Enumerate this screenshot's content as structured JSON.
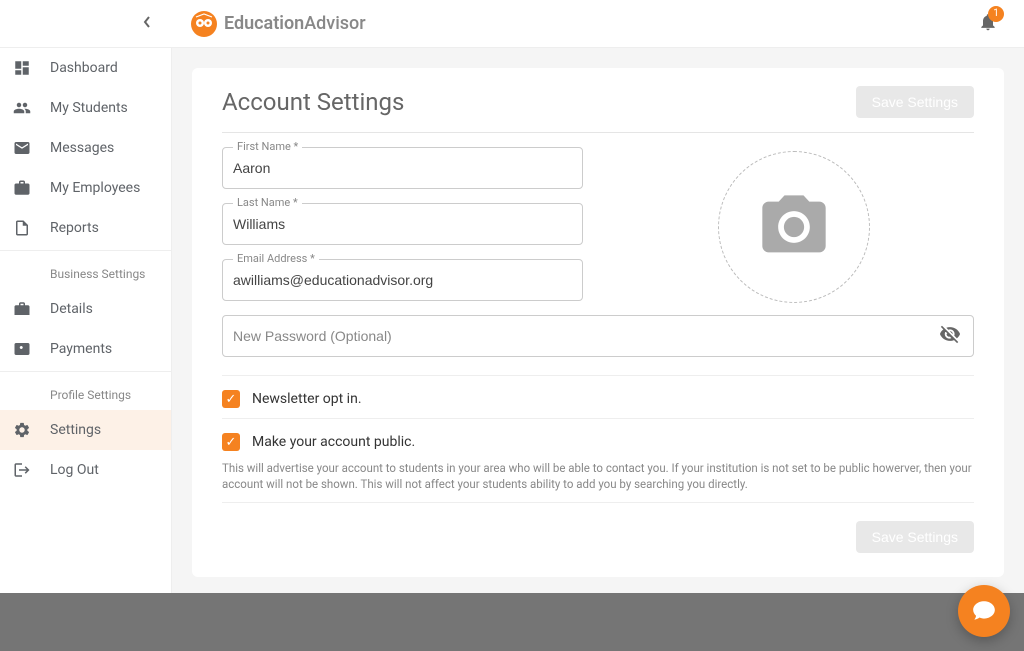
{
  "header": {
    "brand_bold": "Education",
    "brand_light": "Advisor",
    "notifications_count": "1"
  },
  "nav": {
    "items": [
      {
        "label": "Dashboard"
      },
      {
        "label": "My Students"
      },
      {
        "label": "Messages"
      },
      {
        "label": "My Employees"
      },
      {
        "label": "Reports"
      }
    ],
    "business_header": "Business Settings",
    "business": [
      {
        "label": "Details"
      },
      {
        "label": "Payments"
      }
    ],
    "profile_header": "Profile Settings",
    "profile": [
      {
        "label": "Settings"
      },
      {
        "label": "Log Out"
      }
    ]
  },
  "page": {
    "title": "Account Settings",
    "save_label": "Save Settings"
  },
  "form": {
    "first_name_label": "First Name *",
    "first_name_value": "Aaron",
    "last_name_label": "Last Name *",
    "last_name_value": "Williams",
    "email_label": "Email Address *",
    "email_value": "awilliams@educationadvisor.org",
    "password_placeholder": "New Password (Optional)"
  },
  "options": {
    "newsletter_label": "Newsletter opt in.",
    "public_label": "Make your account public.",
    "public_help": "This will advertise your account to students in your area who will be able to contact you. If your institution is not set to be public howerver, then your account will not be shown. This will not affect your students ability to add you by searching you directly."
  }
}
